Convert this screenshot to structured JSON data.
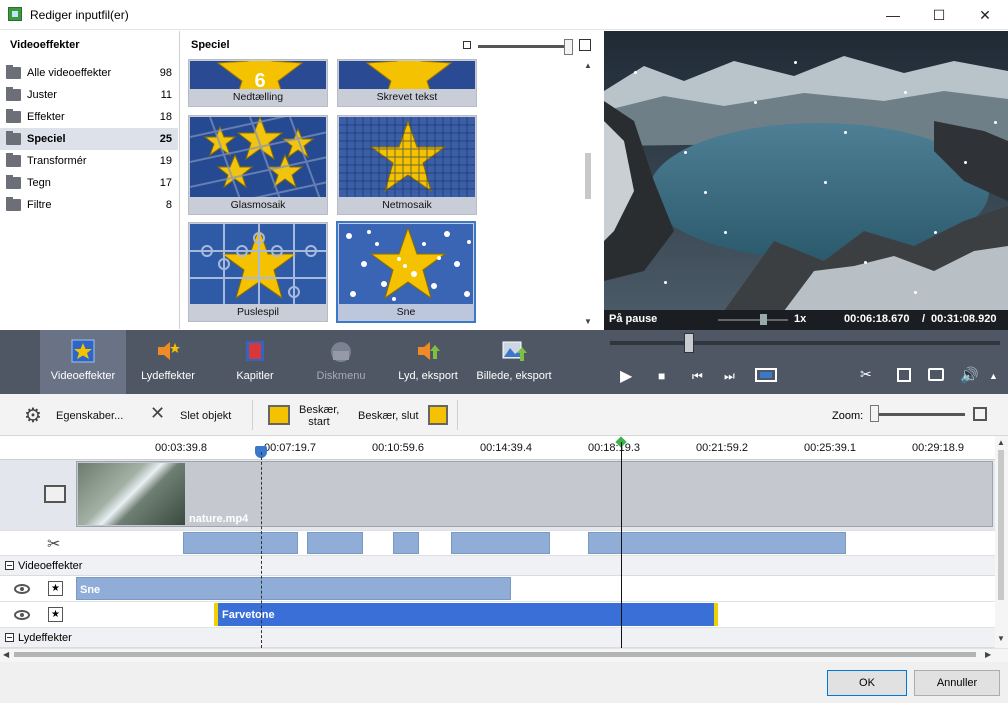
{
  "window": {
    "title": "Rediger inputfil(er)",
    "minimize": "—",
    "maximize": "☐",
    "close": "✕"
  },
  "categories": {
    "title": "Videoeffekter",
    "items": [
      {
        "label": "Alle videoeffekter",
        "count": "98"
      },
      {
        "label": "Juster",
        "count": "11"
      },
      {
        "label": "Effekter",
        "count": "18"
      },
      {
        "label": "Speciel",
        "count": "25"
      },
      {
        "label": "Transformér",
        "count": "19"
      },
      {
        "label": "Tegn",
        "count": "17"
      },
      {
        "label": "Filtre",
        "count": "8"
      }
    ],
    "selected": "Speciel"
  },
  "gallery": {
    "title": "Speciel",
    "tiles": [
      {
        "label": "Nedtælling",
        "badge": "6"
      },
      {
        "label": "Skrevet tekst"
      },
      {
        "label": "Glasmosaik"
      },
      {
        "label": "Netmosaik"
      },
      {
        "label": "Puslespil"
      },
      {
        "label": "Sne"
      }
    ],
    "selected": "Sne"
  },
  "player": {
    "status": "På pause",
    "speed": "1x",
    "time_current": "00:06:18.670",
    "time_separator": "/",
    "time_total": "00:31:08.920"
  },
  "dark_toolbar": [
    {
      "label": "Videoeffekter",
      "icon": "star-film-icon"
    },
    {
      "label": "Lydeffekter",
      "icon": "speaker-star-icon"
    },
    {
      "label": "Kapitler",
      "icon": "chapter-film-icon"
    },
    {
      "label": "Diskmenu",
      "icon": "disc-menu-icon"
    },
    {
      "label": "Lyd, eksport",
      "icon": "speaker-export-icon"
    },
    {
      "label": "Billede, eksport",
      "icon": "image-export-icon"
    }
  ],
  "edit_toolbar": {
    "properties": "Egenskaber...",
    "delete": "Slet objekt",
    "trim_start": "Beskær, start",
    "trim_end": "Beskær, slut",
    "zoom": "Zoom:"
  },
  "ruler": [
    "00:03:39.8",
    "00:07:19.7",
    "00:10:59.6",
    "00:14:39.4",
    "00:18:19.3",
    "00:21:59.2",
    "00:25:39.1",
    "00:29:18.9"
  ],
  "timeline": {
    "clip_name": "nature.mp4",
    "video_fx_header": "Videoeffekter",
    "audio_fx_header": "Lydeffekter",
    "fx": [
      {
        "label": "Sne"
      },
      {
        "label": "Farvetone"
      }
    ]
  },
  "footer": {
    "ok": "OK",
    "cancel": "Annuller"
  }
}
